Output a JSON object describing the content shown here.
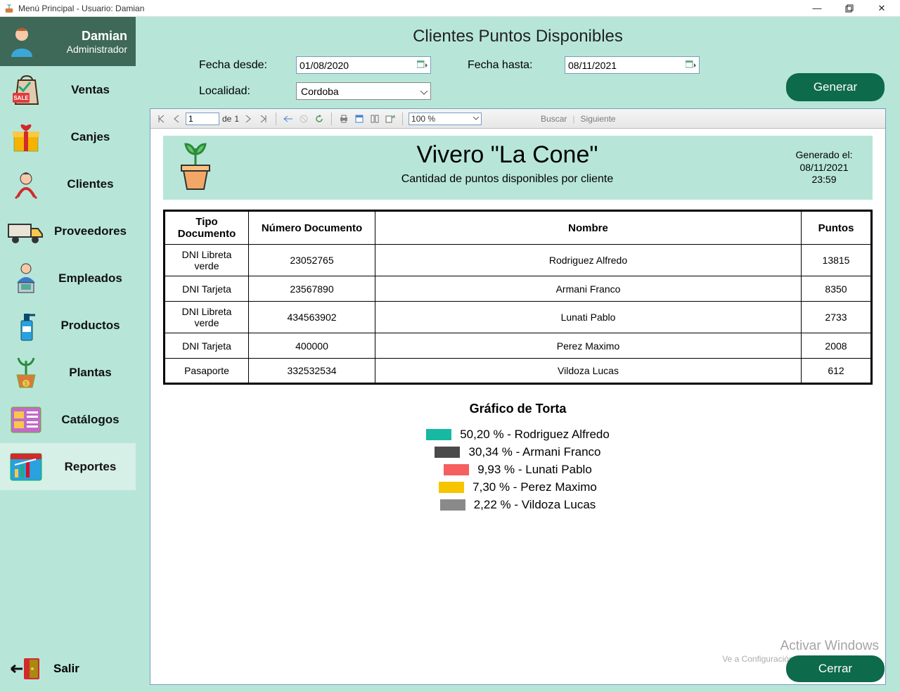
{
  "window": {
    "title": "Menú Principal - Usuario: Damian"
  },
  "user": {
    "name": "Damian",
    "role": "Administrador"
  },
  "sidebar": {
    "items": [
      {
        "label": "Ventas"
      },
      {
        "label": "Canjes"
      },
      {
        "label": "Clientes"
      },
      {
        "label": "Proveedores"
      },
      {
        "label": "Empleados"
      },
      {
        "label": "Productos"
      },
      {
        "label": "Plantas"
      },
      {
        "label": "Catálogos"
      },
      {
        "label": "Reportes"
      }
    ],
    "exit_label": "Salir"
  },
  "main": {
    "title": "Clientes Puntos Disponibles",
    "filters": {
      "from_label": "Fecha desde:",
      "from_value": "01/08/2020",
      "to_label": "Fecha hasta:",
      "to_value": "08/11/2021",
      "locality_label": "Localidad:",
      "locality_value": "Cordoba"
    },
    "generate_label": "Generar",
    "close_label": "Cerrar"
  },
  "viewer": {
    "page_current": "1",
    "page_of_label": "de",
    "page_total": "1",
    "zoom": "100 %",
    "find_label": "Buscar",
    "next_label": "Siguiente"
  },
  "report": {
    "title": "Vivero \"La Cone\"",
    "subtitle": "Cantidad de puntos disponibles por cliente",
    "generated_label": "Generado el:",
    "generated_date": "08/11/2021",
    "generated_time": "23:59",
    "columns": [
      "Tipo Documento",
      "Número Documento",
      "Nombre",
      "Puntos"
    ],
    "rows": [
      [
        "DNI Libreta verde",
        "23052765",
        "Rodriguez Alfredo",
        "13815"
      ],
      [
        "DNI Tarjeta",
        "23567890",
        "Armani Franco",
        "8350"
      ],
      [
        "DNI Libreta verde",
        "434563902",
        "Lunati Pablo",
        "2733"
      ],
      [
        "DNI Tarjeta",
        "400000",
        "Perez Maximo",
        "2008"
      ],
      [
        "Pasaporte",
        "332532534",
        "Vildoza Lucas",
        "612"
      ]
    ],
    "chart_title": "Gráfico de Torta"
  },
  "chart_data": {
    "type": "pie",
    "title": "Gráfico de Torta",
    "series": [
      {
        "name": "Rodriguez Alfredo",
        "value": 50.2,
        "color": "#17b9a3",
        "label": "50,20 % - Rodriguez Alfredo"
      },
      {
        "name": "Armani Franco",
        "value": 30.34,
        "color": "#4a4a4a",
        "label": "30,34 % - Armani Franco"
      },
      {
        "name": "Lunati Pablo",
        "value": 9.93,
        "color": "#f55f5f",
        "label": "9,93 % - Lunati Pablo"
      },
      {
        "name": "Perez Maximo",
        "value": 7.3,
        "color": "#f7c500",
        "label": "7,30 % - Perez Maximo"
      },
      {
        "name": "Vildoza Lucas",
        "value": 2.22,
        "color": "#8a8a8a",
        "label": "2,22 % - Vildoza Lucas"
      }
    ]
  },
  "watermark": {
    "title": "Activar Windows",
    "subtitle": "Ve a Configuración para activar Windows."
  }
}
